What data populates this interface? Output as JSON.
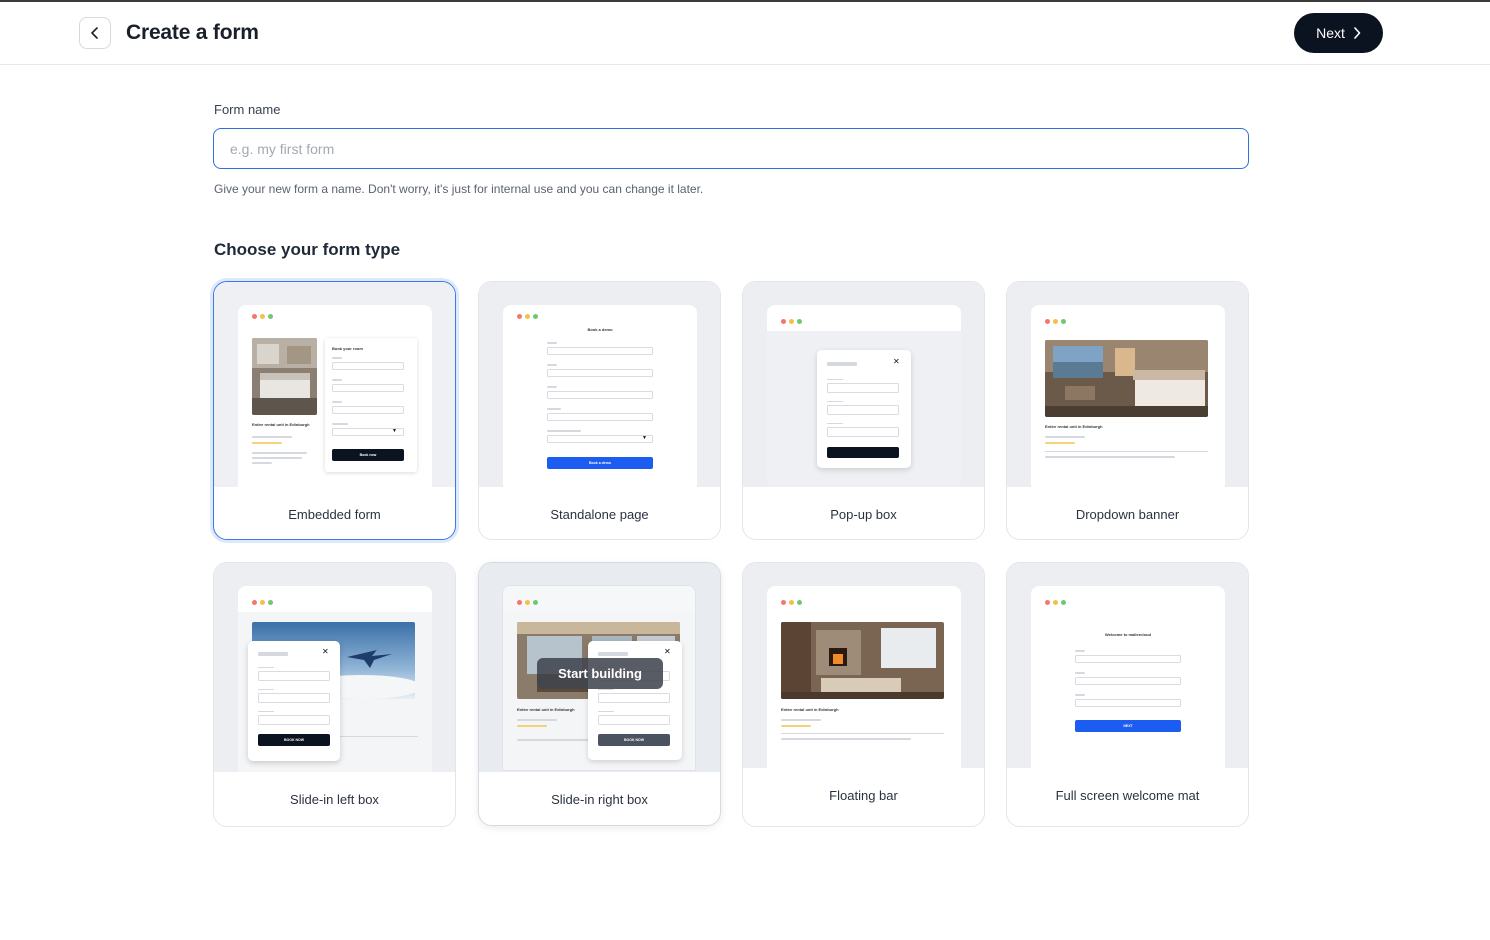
{
  "header": {
    "title": "Create a form",
    "next_label": "Next"
  },
  "form_name": {
    "label": "Form name",
    "placeholder": "e.g. my first form",
    "value": "",
    "helper": "Give your new form a name. Don't worry, it's just for internal use and you can change it later."
  },
  "section_title": "Choose your form type",
  "form_types": [
    {
      "label": "Embedded form",
      "selected": true
    },
    {
      "label": "Standalone page",
      "selected": false
    },
    {
      "label": "Pop-up box",
      "selected": false
    },
    {
      "label": "Dropdown banner",
      "selected": false
    },
    {
      "label": "Slide-in left box",
      "selected": false
    },
    {
      "label": "Slide-in right box",
      "selected": false,
      "hovered": true
    },
    {
      "label": "Floating bar",
      "selected": false
    },
    {
      "label": "Full screen welcome mat",
      "selected": false
    }
  ],
  "previews": {
    "embedded": {
      "heading": "Book your room",
      "listing": "Entire rental unit in Edinburgh",
      "button": "Book now"
    },
    "standalone": {
      "heading": "Book a demo",
      "button": "Book a demo"
    },
    "dropdown": {
      "listing": "Entire rental unit in Edinburgh"
    },
    "slide_left": {
      "button": "BOOK NOW"
    },
    "slide_right": {
      "listing": "Entire rental unit in Edinburgh",
      "button": "BOOK NOW",
      "hover_label": "Start building"
    },
    "floating": {
      "listing": "Entire rental unit in Edinburgh"
    },
    "welcome": {
      "heading": "Welcome to mailercloud",
      "button": "NEXT"
    }
  },
  "colors": {
    "accent": "#2f6fe0",
    "dark_button": "#0b1220",
    "preview_blue_button": "#1d5cf0"
  },
  "icons": {
    "back": "chevron-left-icon",
    "next": "chevron-right-icon",
    "close": "close-icon"
  }
}
